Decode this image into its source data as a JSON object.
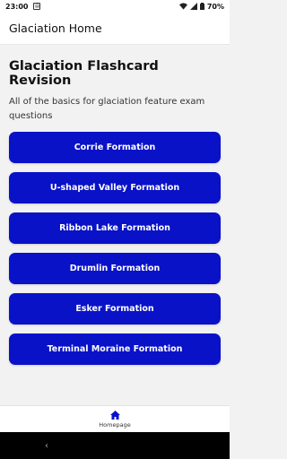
{
  "status_bar": {
    "time": "23:00",
    "battery": "70%"
  },
  "app_bar": {
    "title": "Glaciation Home"
  },
  "main": {
    "title": "Glaciation Flashcard Revision",
    "subtitle": "All of the basics for glaciation feature exam questions",
    "buttons": [
      {
        "label": "Corrie Formation"
      },
      {
        "label": "U-shaped Valley Formation"
      },
      {
        "label": "Ribbon Lake Formation"
      },
      {
        "label": "Drumlin Formation"
      },
      {
        "label": "Esker Formation"
      },
      {
        "label": "Terminal Moraine Formation"
      }
    ]
  },
  "bottom_nav": {
    "home_label": "Homepage"
  },
  "colors": {
    "accent": "#0a12c8",
    "background": "#f2f2f2"
  },
  "icons": [
    "notification-icon",
    "wifi-icon",
    "signal-icon",
    "battery-icon",
    "home-icon",
    "back-icon"
  ]
}
